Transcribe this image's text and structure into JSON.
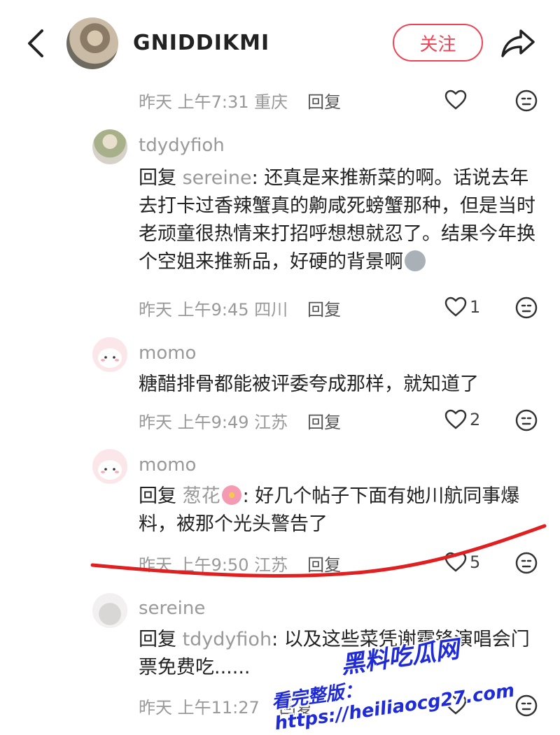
{
  "header": {
    "back_icon": "chevron-left-icon",
    "author_name": "GNIDDIKMI",
    "follow_label": "关注",
    "share_icon": "share-arrow-icon",
    "accent_color": "#ee4455"
  },
  "top_meta": {
    "time": "昨天 上午7:31 重庆",
    "reply_label": "回复"
  },
  "comments": [
    {
      "user": "tdydyfioh",
      "reply_prefix": "回复 ",
      "mention": "sereine",
      "body": ": 还真是来推新菜的啊。话说去年去打卡过香辣蟹真的齁咸死螃蟹那种，但是当时老顽童很热情来打招呼想想就忍了。结果今年换个空姐来推新品，好硬的背景啊",
      "time": "昨天 上午9:45 四川",
      "reply_label": "回复",
      "likes": "1"
    },
    {
      "user": "momo",
      "body": "糖醋排骨都能被评委夸成那样，就知道了",
      "time": "昨天 上午9:49 江苏",
      "reply_label": "回复",
      "likes": "2"
    },
    {
      "user": "momo",
      "reply_prefix": "回复 ",
      "mention": "葱花",
      "body": ": 好几个帖子下面有她川航同事爆料，被那个光头警告了",
      "time": "昨天 上午9:50 江苏",
      "reply_label": "回复",
      "likes": "5"
    },
    {
      "user": "sereine",
      "reply_prefix": "回复 ",
      "mention": "tdydyfioh",
      "body": ": 以及这些菜凭谢霆锋演唱会门票免费吃......",
      "time": "昨天 上午11:27",
      "reply_label": "回复"
    }
  ],
  "watermark": {
    "title": "黑料吃瓜网",
    "url": "看完整版：https://heiliaocg27.com"
  }
}
